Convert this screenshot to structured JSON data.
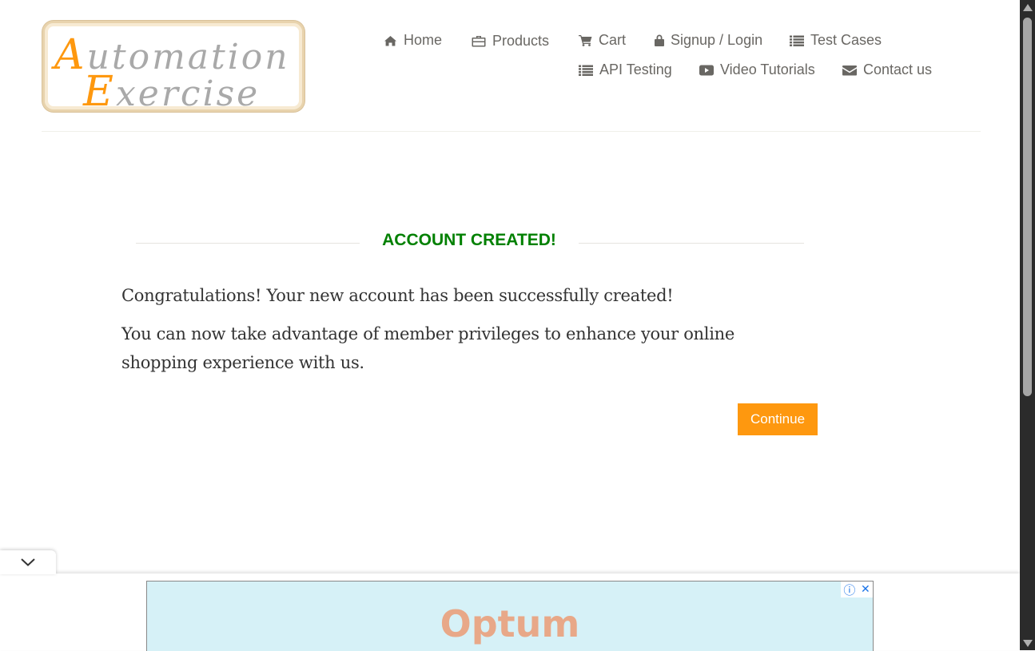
{
  "logo": {
    "line1_initial": "A",
    "line1_rest": "utomation",
    "line2_initial": "E",
    "line2_rest": "xercise"
  },
  "nav": {
    "home": "Home",
    "products": "Products",
    "cart": "Cart",
    "signup_login": "Signup / Login",
    "test_cases": "Test Cases",
    "api_testing": "API Testing",
    "video_tutorials": "Video Tutorials",
    "contact_us": "Contact us"
  },
  "content": {
    "title": "ACCOUNT CREATED!",
    "message1": "Congratulations! Your new account has been successfully created!",
    "message2": "You can now take advantage of member privileges to enhance your online shopping experience with us.",
    "continue_label": "Continue"
  },
  "ad": {
    "brand": "Optum",
    "info_glyph": "ⓘ",
    "close_glyph": "✕"
  },
  "colors": {
    "accent": "#fe980f",
    "success": "#008000",
    "nav_text": "#696763"
  }
}
